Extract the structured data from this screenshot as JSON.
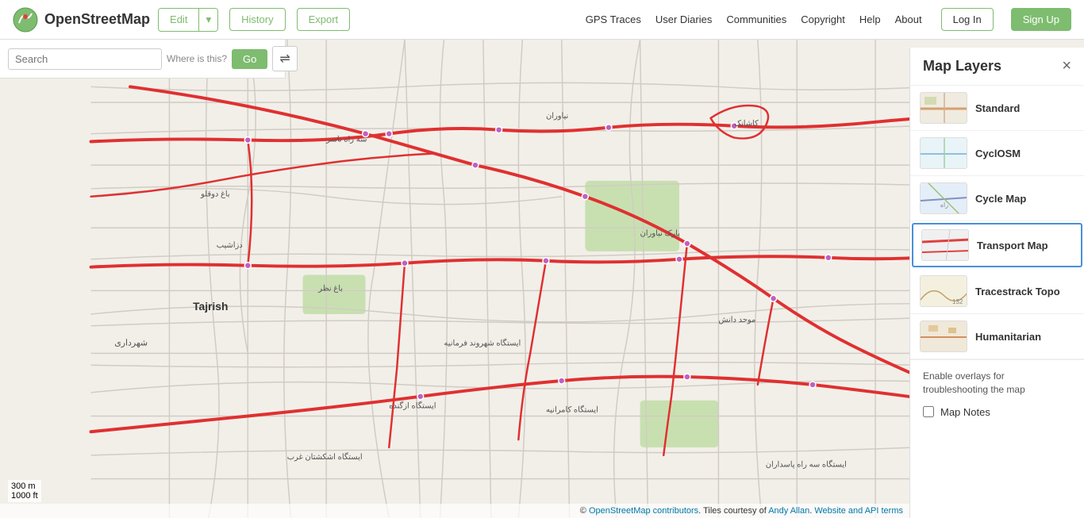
{
  "header": {
    "logo_text": "OpenStreetMap",
    "edit_label": "Edit",
    "history_label": "History",
    "export_label": "Export",
    "nav_links": [
      "GPS Traces",
      "User Diaries",
      "Communities",
      "Copyright",
      "Help",
      "About"
    ],
    "login_label": "Log In",
    "signup_label": "Sign Up"
  },
  "search": {
    "placeholder": "Search",
    "where_label": "Where is this?",
    "go_label": "Go"
  },
  "map_controls": {
    "zoom_in": "+",
    "zoom_out": "−",
    "locate_icon": "⊕",
    "layers_icon": "≡",
    "info_icon": "ℹ",
    "share_icon": "↗",
    "note_icon": "✎",
    "query_icon": "?"
  },
  "layers_panel": {
    "title": "Map Layers",
    "close_icon": "×",
    "layers": [
      {
        "id": "standard",
        "name": "Standard",
        "active": false
      },
      {
        "id": "cyclosm",
        "name": "CyclOSM",
        "active": false
      },
      {
        "id": "cyclemap",
        "name": "Cycle Map",
        "active": false
      },
      {
        "id": "transport",
        "name": "Transport Map",
        "active": true
      },
      {
        "id": "tracestrack",
        "name": "Tracestrack Topo",
        "active": false
      },
      {
        "id": "humanitarian",
        "name": "Humanitarian",
        "active": false
      }
    ],
    "overlays_title": "Enable overlays for troubleshooting the map",
    "overlay_items": [
      {
        "id": "map-notes",
        "label": "Map Notes"
      }
    ]
  },
  "attribution": {
    "text": "© OpenStreetMap contributors. Tiles courtesy of Andy Allan. Website and API terms"
  },
  "scale": {
    "metric": "300 m",
    "imperial": "1000 ft"
  }
}
